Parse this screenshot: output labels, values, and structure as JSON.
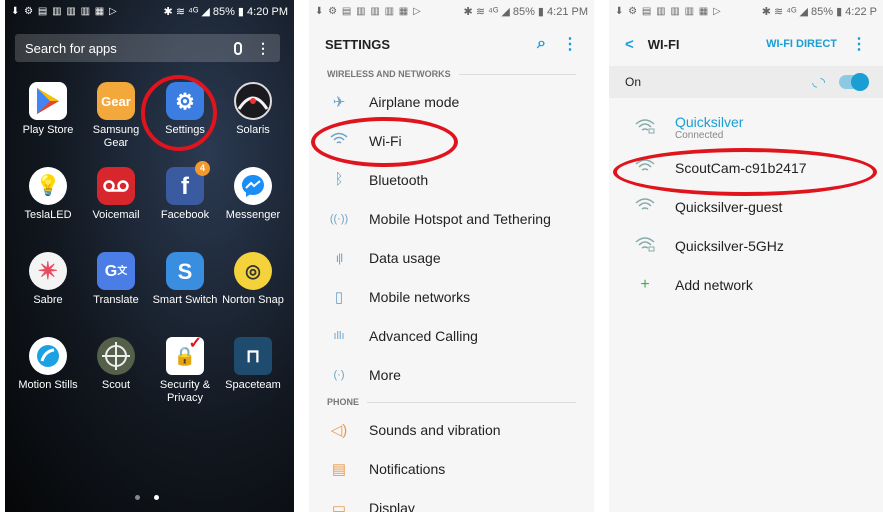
{
  "home": {
    "status": {
      "left": "⬇ ⚙ ▤ ▥ ▥ ▥ ▦ ▷",
      "right": "✱ ≋ ⁴ᴳ ◢ 85% ▮ 4:20 PM"
    },
    "search_placeholder": "Search for apps",
    "apps": [
      {
        "label": "Play Store"
      },
      {
        "label": "Samsung Gear"
      },
      {
        "label": "Settings"
      },
      {
        "label": "Solaris"
      },
      {
        "label": "TeslaLED"
      },
      {
        "label": "Voicemail"
      },
      {
        "label": "Facebook",
        "badge": "4"
      },
      {
        "label": "Messenger"
      },
      {
        "label": "Sabre"
      },
      {
        "label": "Translate"
      },
      {
        "label": "Smart Switch"
      },
      {
        "label": "Norton Snap"
      },
      {
        "label": "Motion Stills"
      },
      {
        "label": "Scout"
      },
      {
        "label": "Security & Privacy"
      },
      {
        "label": "Spaceteam"
      }
    ]
  },
  "settings": {
    "status": {
      "left": "⬇ ⚙ ▤ ▥ ▥ ▥ ▦ ▷",
      "right": "✱ ≋ ⁴ᴳ ◢ 85% ▮ 4:21 PM"
    },
    "title": "SETTINGS",
    "section_wireless": "WIRELESS AND NETWORKS",
    "items": [
      {
        "label": "Airplane mode",
        "icon": "airplane-icon"
      },
      {
        "label": "Wi-Fi",
        "icon": "wifi-icon"
      },
      {
        "label": "Bluetooth",
        "icon": "bluetooth-icon"
      },
      {
        "label": "Mobile Hotspot and Tethering",
        "icon": "hotspot-icon"
      },
      {
        "label": "Data usage",
        "icon": "data-usage-icon"
      },
      {
        "label": "Mobile networks",
        "icon": "mobile-networks-icon"
      },
      {
        "label": "Advanced Calling",
        "icon": "advanced-calling-icon"
      },
      {
        "label": "More",
        "icon": "more-icon"
      }
    ],
    "section_phone": "PHONE",
    "phone_items": [
      {
        "label": "Sounds and vibration",
        "icon": "sound-icon"
      },
      {
        "label": "Notifications",
        "icon": "notifications-icon"
      },
      {
        "label": "Display",
        "icon": "display-icon"
      }
    ]
  },
  "wifi": {
    "status": {
      "left": "⬇ ⚙ ▤ ▥ ▥ ▥ ▦ ▷",
      "right": "✱ ≋ ⁴ᴳ ◢ 85% ▮ 4:22 P"
    },
    "back": "<",
    "title": "WI-FI",
    "direct": "WI-FI DIRECT",
    "on_label": "On",
    "networks": [
      {
        "name": "Quicksilver",
        "status": "Connected",
        "locked": true
      },
      {
        "name": "ScoutCam-c91b2417",
        "locked": false
      },
      {
        "name": "Quicksilver-guest",
        "locked": false
      },
      {
        "name": "Quicksilver-5GHz",
        "locked": true
      }
    ],
    "add_network": "Add network"
  },
  "colors": {
    "accent": "#1a9ed3",
    "highlight_ring": "#e0141c"
  }
}
